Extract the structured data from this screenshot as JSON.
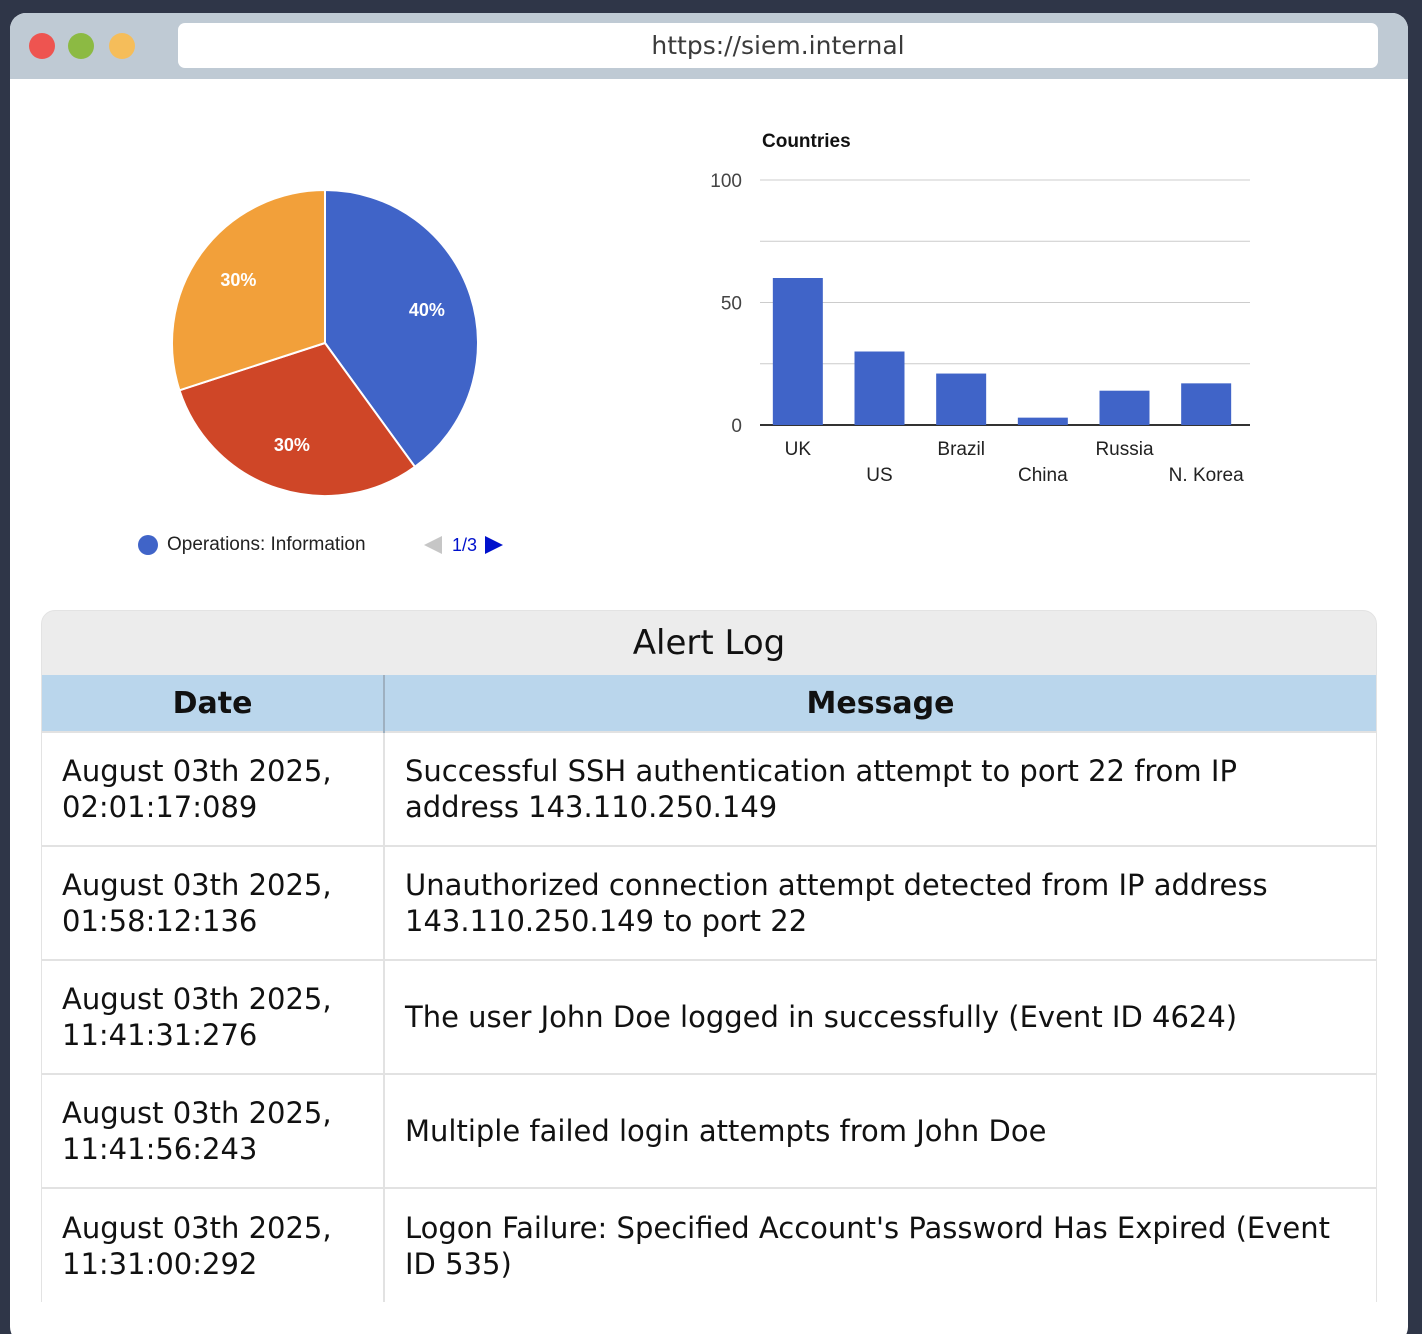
{
  "browser": {
    "url": "https://siem.internal"
  },
  "pie": {
    "slices": [
      {
        "label": "40%",
        "value": 40,
        "color": "#4064c8"
      },
      {
        "label": "30%",
        "value": 30,
        "color": "#cf4627"
      },
      {
        "label": "30%",
        "value": 30,
        "color": "#f2a03a"
      }
    ],
    "legend_label": "Operations: Information",
    "legend_color": "#4064c8",
    "pager": "1/3"
  },
  "chart_data": [
    {
      "type": "pie",
      "values": [
        40,
        30,
        30
      ],
      "labels": [
        "40%",
        "30%",
        "30%"
      ],
      "legend": [
        "Operations: Information"
      ],
      "colors": [
        "#4064c8",
        "#cf4627",
        "#f2a03a"
      ]
    },
    {
      "type": "bar",
      "title": "Countries",
      "categories": [
        "UK",
        "US",
        "Brazil",
        "China",
        "Russia",
        "N. Korea"
      ],
      "values": [
        60,
        30,
        21,
        3,
        14,
        17
      ],
      "ylim": [
        0,
        100
      ],
      "yticks": [
        "0",
        "50",
        "100"
      ],
      "grid": true,
      "color": "#4064c8"
    }
  ],
  "alert_log": {
    "title": "Alert Log",
    "headers": [
      "Date",
      "Message"
    ],
    "rows": [
      {
        "date": "August 03th 2025, 02:01:17:089",
        "message": "Successful SSH authentication attempt to port 22 from IP address 143.110.250.149"
      },
      {
        "date": "August 03th 2025, 01:58:12:136",
        "message": "Unauthorized connection attempt detected from IP address 143.110.250.149 to port 22"
      },
      {
        "date": "August 03th 2025, 11:41:31:276",
        "message": "The user John Doe logged in successfully (Event ID 4624)"
      },
      {
        "date": "August 03th 2025, 11:41:56:243",
        "message": "Multiple failed login attempts from John Doe"
      },
      {
        "date": "August 03th 2025, 11:31:00:292",
        "message": "Logon Failure: Specified Account's Password Has Expired (Event ID 535)"
      }
    ]
  }
}
